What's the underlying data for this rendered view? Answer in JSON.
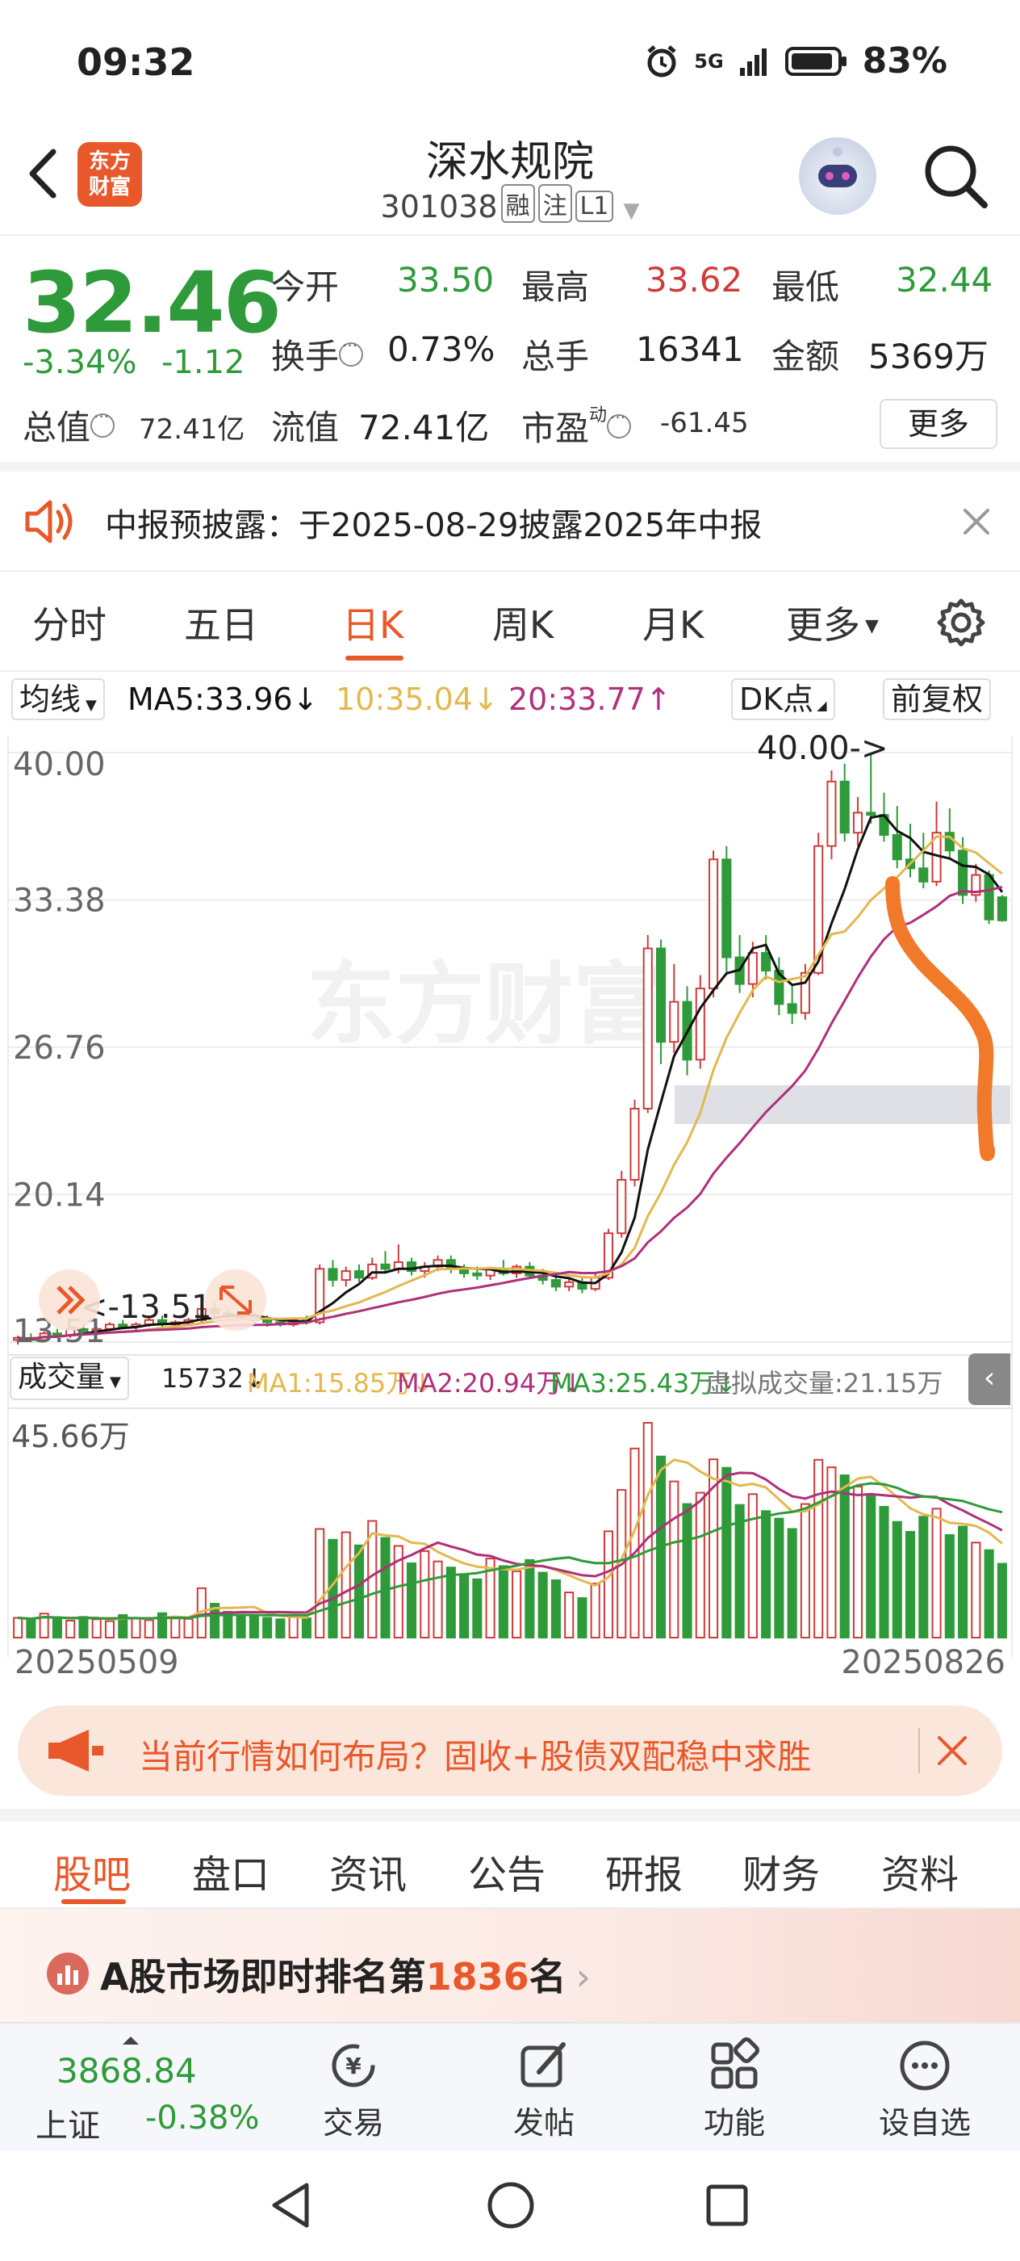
{
  "status_bar": {
    "time": "09:32",
    "network": "5G",
    "battery": "83%"
  },
  "header": {
    "logo_line1": "东方",
    "logo_line2": "财富",
    "stock_name": "深水规院",
    "stock_code": "301038",
    "tags": [
      "融",
      "注",
      "L1"
    ]
  },
  "quote": {
    "price": "32.46",
    "change_pct": "-3.34%",
    "change": "-1.12",
    "open_label": "今开",
    "open": "33.50",
    "high_label": "最高",
    "high": "33.62",
    "low_label": "最低",
    "low": "32.44",
    "turnover_label": "换手",
    "turnover": "0.73%",
    "volume_label": "总手",
    "volume": "16341",
    "amount_label": "金额",
    "amount": "5369万",
    "total_cap_label": "总值",
    "total_cap": "72.41亿",
    "float_cap_label": "流值",
    "float_cap": "72.41亿",
    "pe_label": "市盈",
    "pe_sup": "动",
    "pe": "-61.45",
    "more_label": "更多"
  },
  "notice": {
    "text": "中报预披露：于2025-08-29披露2025年中报"
  },
  "period_tabs": [
    "分时",
    "五日",
    "日K",
    "周K",
    "月K",
    "更多"
  ],
  "period_active_index": 2,
  "ma_legend": {
    "selector": "均线",
    "ma5": "MA5:33.96",
    "ma10": "10:35.04",
    "ma20": "20:33.77",
    "dk_label": "DK点",
    "adjust_label": "前复权"
  },
  "volume_legend": {
    "selector": "成交量",
    "vol": "15732",
    "ma1": "MA1:15.85万",
    "ma2": "MA2:20.94万",
    "ma3": "MA3:25.43万",
    "virtual": "虚拟成交量:21.15万"
  },
  "ad_banner": {
    "text": "当前行情如何布局？固收+股债双配稳中求胜"
  },
  "sub_tabs": [
    "股吧",
    "盘口",
    "资讯",
    "公告",
    "研报",
    "财务",
    "资料"
  ],
  "sub_active_index": 0,
  "rank": {
    "prefix": "A股市场即时排名第",
    "number": "1836",
    "suffix": "名"
  },
  "bottom_bar": {
    "index_value": "3868.84",
    "index_name": "上证",
    "index_change": "-0.38%",
    "trade": "交易",
    "post": "发帖",
    "functions": "功能",
    "watchlist": "设自选"
  },
  "colors": {
    "up": "#d03a3a",
    "down": "#2e9a3a",
    "accent": "#e8582a",
    "ma5": "#111111",
    "ma10": "#e2b84f",
    "ma20": "#b0307a"
  },
  "chart_data": {
    "type": "candlestick",
    "watermark": "东方财富",
    "y_ticks": [
      "40.00",
      "33.38",
      "26.76",
      "20.14",
      "13.51"
    ],
    "ylim": [
      13.51,
      40.0
    ],
    "max_annotation": "40.00->",
    "min_annotation": "<-13.51",
    "x_start": "20250509",
    "x_end": "20250826",
    "volume_max_label": "45.66万",
    "candles": [
      [
        13.6,
        13.8,
        13.4,
        13.7
      ],
      [
        13.7,
        13.9,
        13.5,
        13.6
      ],
      [
        13.6,
        14.0,
        13.5,
        13.9
      ],
      [
        13.9,
        14.1,
        13.7,
        13.8
      ],
      [
        13.8,
        14.2,
        13.7,
        14.1
      ],
      [
        14.1,
        14.3,
        13.9,
        14.0
      ],
      [
        14.0,
        14.2,
        13.8,
        14.1
      ],
      [
        14.1,
        14.4,
        14.0,
        14.3
      ],
      [
        14.3,
        14.5,
        14.1,
        14.2
      ],
      [
        14.2,
        14.4,
        14.0,
        14.3
      ],
      [
        14.3,
        14.6,
        14.2,
        14.5
      ],
      [
        14.5,
        14.7,
        14.2,
        14.3
      ],
      [
        14.3,
        14.5,
        14.1,
        14.4
      ],
      [
        14.4,
        14.6,
        14.3,
        14.5
      ],
      [
        14.5,
        15.2,
        14.4,
        15.0
      ],
      [
        15.0,
        15.3,
        14.6,
        14.8
      ],
      [
        14.8,
        15.0,
        14.5,
        14.7
      ],
      [
        14.7,
        14.9,
        14.5,
        14.6
      ],
      [
        14.6,
        14.8,
        14.3,
        14.5
      ],
      [
        14.5,
        14.7,
        14.2,
        14.4
      ],
      [
        14.4,
        14.6,
        14.2,
        14.3
      ],
      [
        14.3,
        14.6,
        14.2,
        14.5
      ],
      [
        14.5,
        14.7,
        14.3,
        14.4
      ],
      [
        14.4,
        17.0,
        14.3,
        16.8
      ],
      [
        16.8,
        17.2,
        16.0,
        16.3
      ],
      [
        16.3,
        16.9,
        16.0,
        16.7
      ],
      [
        16.7,
        17.0,
        16.2,
        16.4
      ],
      [
        16.4,
        17.3,
        16.3,
        17.0
      ],
      [
        17.0,
        17.6,
        16.6,
        16.8
      ],
      [
        16.8,
        17.9,
        16.6,
        17.1
      ],
      [
        17.1,
        17.3,
        16.5,
        16.7
      ],
      [
        16.7,
        17.1,
        16.4,
        16.9
      ],
      [
        16.9,
        17.4,
        16.7,
        17.2
      ],
      [
        17.2,
        17.4,
        16.6,
        16.8
      ],
      [
        16.8,
        17.0,
        16.4,
        16.6
      ],
      [
        16.6,
        16.9,
        16.3,
        16.5
      ],
      [
        16.5,
        16.9,
        16.3,
        16.8
      ],
      [
        16.8,
        17.2,
        16.5,
        16.6
      ],
      [
        16.6,
        17.0,
        16.4,
        16.9
      ],
      [
        16.9,
        17.1,
        16.4,
        16.5
      ],
      [
        16.5,
        16.8,
        16.1,
        16.3
      ],
      [
        16.3,
        16.5,
        15.8,
        16.0
      ],
      [
        16.0,
        16.4,
        15.8,
        16.2
      ],
      [
        16.2,
        16.4,
        15.7,
        15.9
      ],
      [
        15.9,
        16.6,
        15.8,
        16.4
      ],
      [
        16.4,
        18.6,
        16.3,
        18.4
      ],
      [
        18.4,
        21.2,
        18.2,
        20.8
      ],
      [
        20.8,
        24.4,
        20.5,
        24.0
      ],
      [
        24.0,
        31.8,
        23.8,
        31.2
      ],
      [
        31.2,
        31.6,
        26.0,
        27.0
      ],
      [
        27.0,
        30.5,
        26.5,
        28.8
      ],
      [
        28.8,
        29.5,
        25.5,
        26.2
      ],
      [
        26.2,
        30.0,
        25.8,
        29.4
      ],
      [
        29.4,
        35.6,
        29.0,
        35.2
      ],
      [
        35.2,
        35.8,
        30.0,
        30.8
      ],
      [
        30.8,
        31.8,
        29.2,
        29.6
      ],
      [
        29.6,
        31.5,
        29.0,
        31.0
      ],
      [
        31.0,
        31.8,
        29.8,
        30.2
      ],
      [
        30.2,
        30.8,
        28.2,
        28.7
      ],
      [
        28.7,
        29.6,
        27.8,
        28.3
      ],
      [
        28.3,
        30.5,
        28.0,
        30.1
      ],
      [
        30.1,
        36.4,
        30.0,
        35.8
      ],
      [
        35.8,
        39.2,
        35.2,
        38.7
      ],
      [
        38.7,
        39.5,
        36.0,
        36.4
      ],
      [
        36.4,
        38.0,
        35.8,
        37.3
      ],
      [
        37.3,
        40.0,
        36.8,
        37.2
      ],
      [
        37.2,
        38.2,
        36.0,
        36.3
      ],
      [
        36.3,
        37.6,
        34.8,
        35.2
      ],
      [
        35.2,
        36.8,
        34.4,
        34.8
      ],
      [
        34.8,
        36.4,
        33.9,
        34.2
      ],
      [
        34.2,
        37.8,
        34.0,
        36.4
      ],
      [
        36.4,
        37.5,
        35.2,
        35.6
      ],
      [
        35.6,
        36.2,
        33.2,
        33.6
      ],
      [
        33.6,
        35.0,
        33.3,
        34.5
      ],
      [
        34.5,
        34.7,
        32.3,
        32.5
      ],
      [
        33.5,
        33.6,
        32.4,
        32.46
      ]
    ],
    "volume_wan": [
      4.2,
      3.8,
      5.1,
      4.0,
      3.6,
      4.4,
      3.9,
      3.5,
      4.8,
      4.1,
      3.7,
      5.2,
      4.4,
      4.0,
      10.5,
      7.2,
      5.5,
      4.8,
      4.6,
      4.2,
      3.9,
      4.5,
      4.1,
      23.1,
      20.8,
      22.4,
      19.6,
      24.8,
      21.2,
      19.5,
      15.8,
      18.4,
      16.2,
      14.9,
      13.5,
      12.4,
      16.8,
      15.2,
      14.1,
      16.5,
      13.8,
      12.2,
      9.6,
      8.4,
      11.5,
      22.6,
      31.4,
      40.2,
      45.66,
      38.5,
      33.2,
      28.4,
      30.8,
      37.9,
      36.1,
      28.2,
      30.5,
      26.9,
      25.3,
      23.1,
      28.4,
      37.8,
      36.2,
      34.5,
      32.1,
      30.4,
      27.8,
      24.6,
      22.5,
      25.7,
      27.4,
      21.8,
      23.6,
      20.2,
      18.6,
      15.7
    ]
  }
}
